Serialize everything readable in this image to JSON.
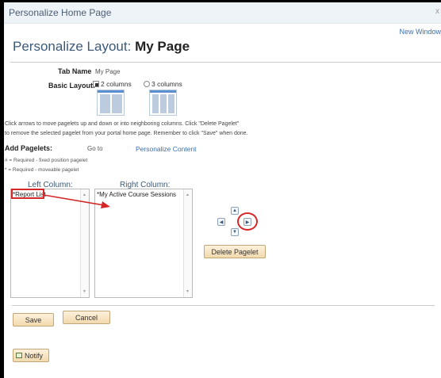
{
  "window": {
    "title": "Personalize Home Page",
    "close_glyph": "x",
    "new_window_link": "New Window"
  },
  "heading": {
    "prefix": "Personalize Layout:",
    "page_name": "My Page"
  },
  "tab_name": {
    "label": "Tab Name",
    "value": "My Page"
  },
  "basic_layout": {
    "label": "Basic Layout:",
    "options": [
      {
        "label": "2 columns",
        "selected": true
      },
      {
        "label": "3 columns",
        "selected": false
      }
    ]
  },
  "instructions": {
    "line1": "Click arrows to move pagelets up and down or into neighboring columns. Click \"Delete Pagelet\"",
    "line2": "to remove the selected pagelet from your portal home page. Remember to click \"Save\" when done."
  },
  "add_pagelets": {
    "label": "Add Pagelets:",
    "go_to": "Go to",
    "link": "Personalize Content"
  },
  "legend": {
    "fixed": "# = Required - fixed position pagelet",
    "movable": "* = Required - moveable pagelet"
  },
  "columns": {
    "left": {
      "title": "Left Column:",
      "items": [
        "*Report List"
      ]
    },
    "right": {
      "title": "Right Column:",
      "items": [
        "*My Active Course Sessions"
      ]
    }
  },
  "mover": {
    "up_icon": "▲",
    "down_icon": "▼",
    "left_icon": "◀",
    "right_icon": "▶"
  },
  "buttons": {
    "delete_pagelet": "Delete Pagelet",
    "save": "Save",
    "cancel": "Cancel",
    "notify": "Notify"
  },
  "annotation_color": "#d42828"
}
